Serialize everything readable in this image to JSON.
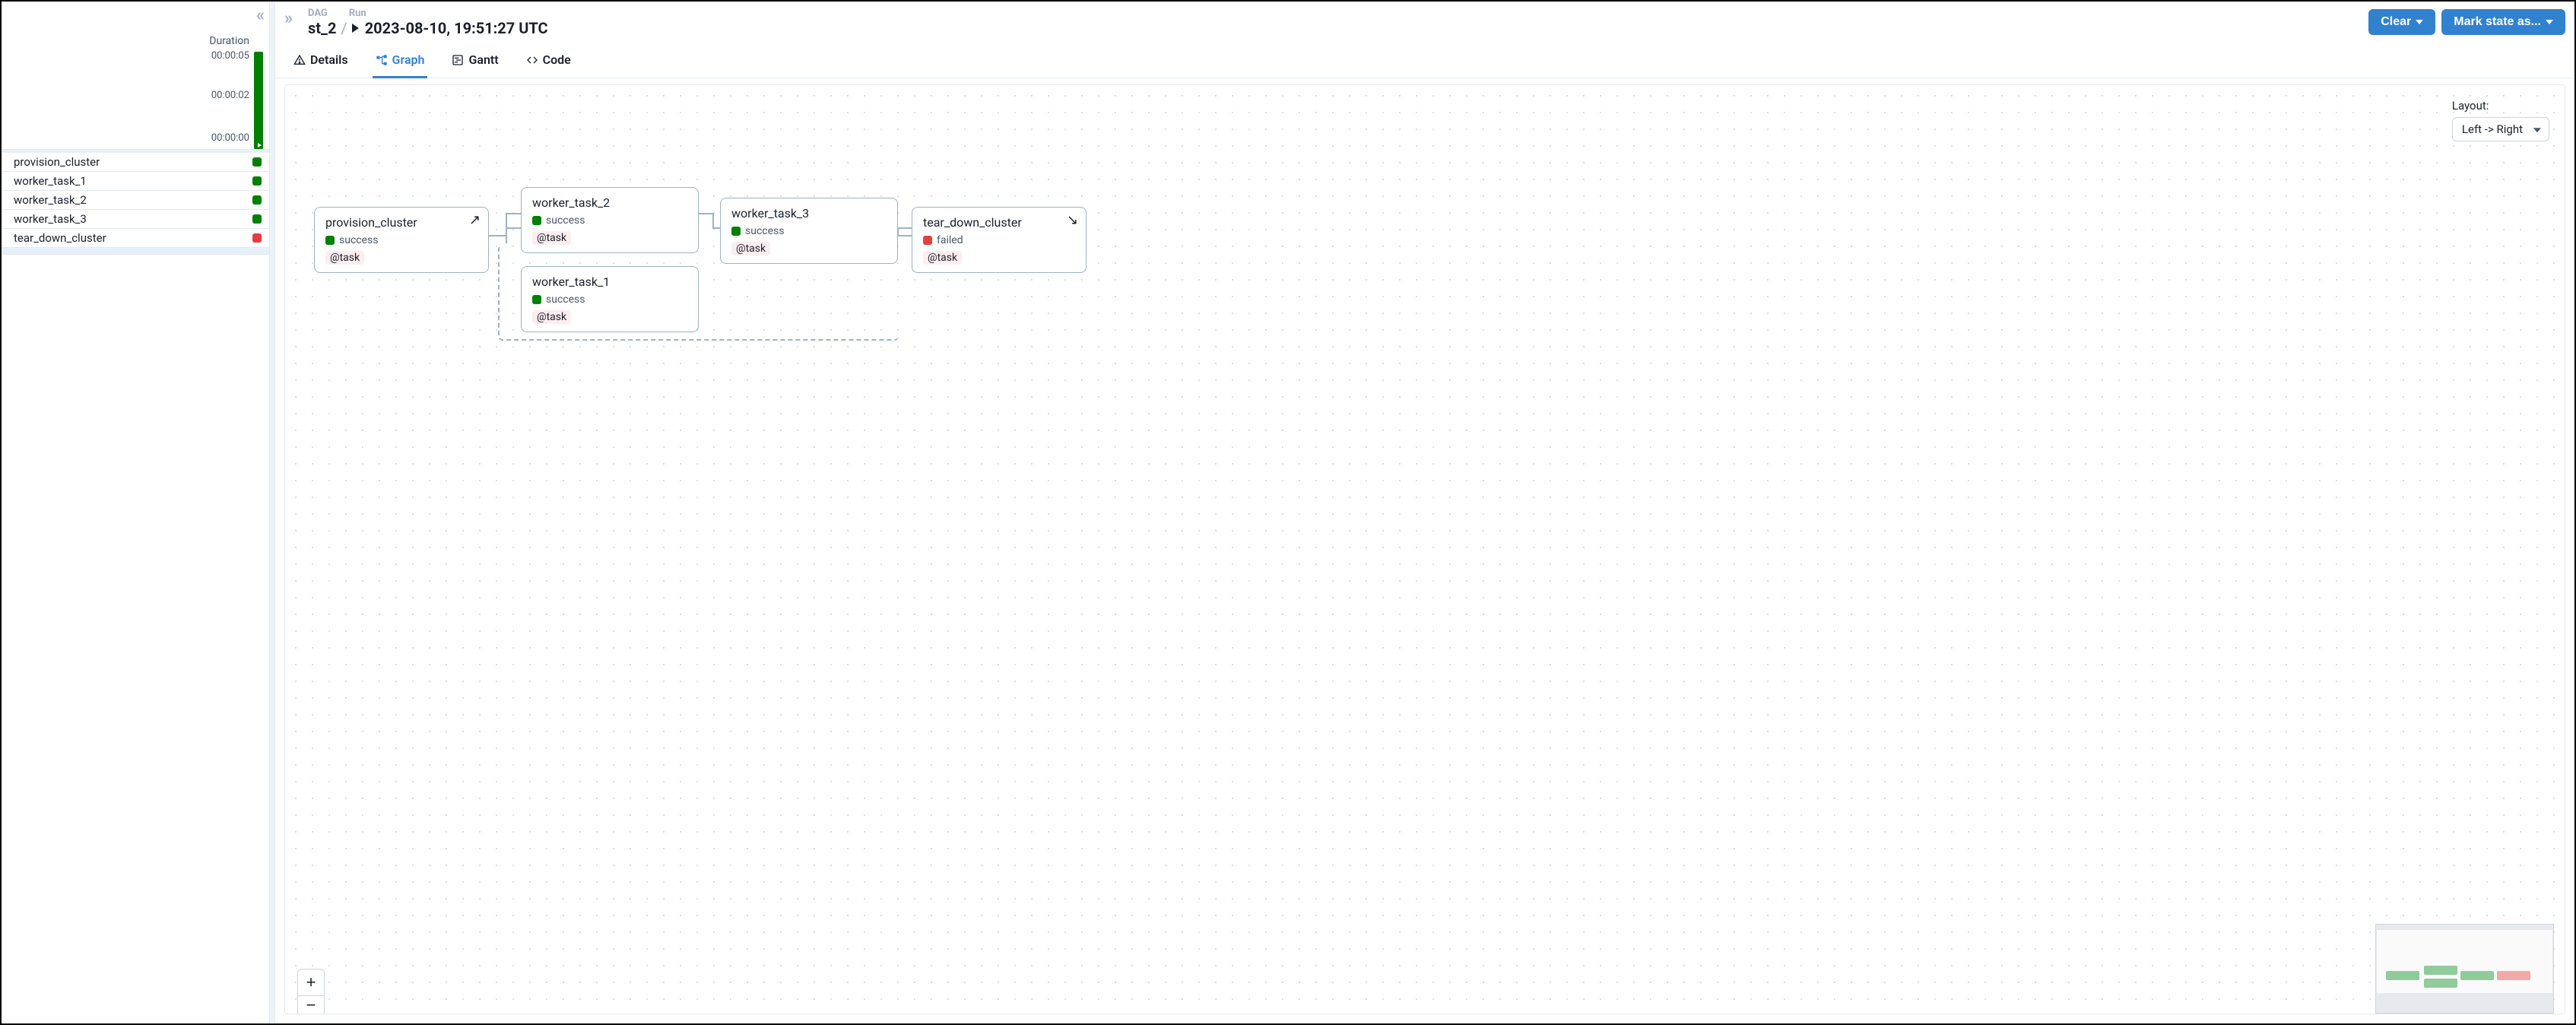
{
  "sidebar": {
    "duration_label": "Duration",
    "ticks": [
      "00:00:05",
      "00:00:02",
      "00:00:00"
    ],
    "tasks": [
      {
        "name": "provision_cluster",
        "state": "success"
      },
      {
        "name": "worker_task_1",
        "state": "success"
      },
      {
        "name": "worker_task_2",
        "state": "success"
      },
      {
        "name": "worker_task_3",
        "state": "success"
      },
      {
        "name": "tear_down_cluster",
        "state": "failed"
      }
    ]
  },
  "header": {
    "crumb_dag_label": "DAG",
    "crumb_run_label": "Run",
    "dag_id": "st_2",
    "run_ts": "2023-08-10, 19:51:27 UTC",
    "clear_btn": "Clear",
    "mark_state_btn": "Mark state as..."
  },
  "tabs": {
    "details": "Details",
    "graph": "Graph",
    "gantt": "Gantt",
    "code": "Code",
    "active": "graph"
  },
  "layout": {
    "label": "Layout:",
    "selected": "Left -> Right"
  },
  "graph": {
    "nodes": {
      "provision_cluster": {
        "title": "provision_cluster",
        "state": "success",
        "tag": "@task",
        "corner": "setup"
      },
      "worker_task_2": {
        "title": "worker_task_2",
        "state": "success",
        "tag": "@task"
      },
      "worker_task_1": {
        "title": "worker_task_1",
        "state": "success",
        "tag": "@task"
      },
      "worker_task_3": {
        "title": "worker_task_3",
        "state": "success",
        "tag": "@task"
      },
      "tear_down_cluster": {
        "title": "tear_down_cluster",
        "state": "failed",
        "tag": "@task",
        "corner": "teardown"
      }
    }
  },
  "colors": {
    "success": "#008000",
    "failed": "#E53E3E",
    "accent": "#3182CE"
  }
}
